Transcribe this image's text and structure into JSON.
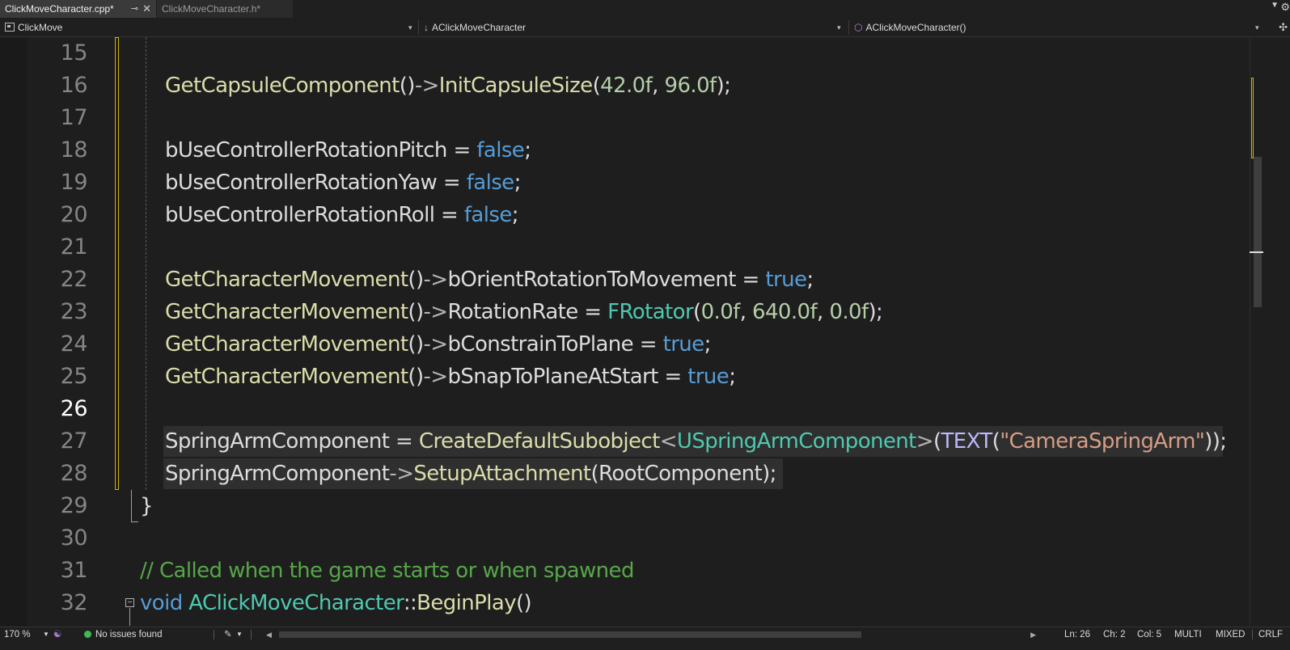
{
  "tabs": [
    {
      "label": "ClickMoveCharacter.cpp*",
      "active": true
    },
    {
      "label": "ClickMoveCharacter.h*",
      "active": false
    }
  ],
  "nav": {
    "project": "ClickMove",
    "class": "AClickMoveCharacter",
    "member": "AClickMoveCharacter()"
  },
  "editor": {
    "current_line": 26,
    "lines": [
      {
        "n": "15"
      },
      {
        "n": "16"
      },
      {
        "n": "17"
      },
      {
        "n": "18"
      },
      {
        "n": "19"
      },
      {
        "n": "20"
      },
      {
        "n": "21"
      },
      {
        "n": "22"
      },
      {
        "n": "23"
      },
      {
        "n": "24"
      },
      {
        "n": "25"
      },
      {
        "n": "26"
      },
      {
        "n": "27"
      },
      {
        "n": "28"
      },
      {
        "n": "29"
      },
      {
        "n": "30"
      },
      {
        "n": "31"
      },
      {
        "n": "32"
      }
    ],
    "code": {
      "l16": {
        "a": "GetCapsuleComponent",
        "b": "()",
        "c": "->",
        "d": "InitCapsuleSize",
        "e": "(",
        "f": "42.0f",
        "g": ", ",
        "h": "96.0f",
        "i": ");"
      },
      "l18": {
        "a": "bUseControllerRotationPitch = ",
        "b": "false",
        "c": ";"
      },
      "l19": {
        "a": "bUseControllerRotationYaw = ",
        "b": "false",
        "c": ";"
      },
      "l20": {
        "a": "bUseControllerRotationRoll = ",
        "b": "false",
        "c": ";"
      },
      "l22": {
        "a": "GetCharacterMovement",
        "b": "()",
        "c": "->",
        "d": "bOrientRotationToMovement = ",
        "e": "true",
        "f": ";"
      },
      "l23": {
        "a": "GetCharacterMovement",
        "b": "()",
        "c": "->",
        "d": "RotationRate = ",
        "e": "FRotator",
        "f": "(",
        "g": "0.0f",
        "h": ", ",
        "i": "640.0f",
        "j": ", ",
        "k": "0.0f",
        "l": ");"
      },
      "l24": {
        "a": "GetCharacterMovement",
        "b": "()",
        "c": "->",
        "d": "bConstrainToPlane = ",
        "e": "true",
        "f": ";"
      },
      "l25": {
        "a": "GetCharacterMovement",
        "b": "()",
        "c": "->",
        "d": "bSnapToPlaneAtStart = ",
        "e": "true",
        "f": ";"
      },
      "l27": {
        "a": "SpringArmComponent = ",
        "b": "CreateDefaultSubobject",
        "c": "<",
        "d": "USpringArmComponent",
        "e": ">",
        "f": "(",
        "g": "TEXT",
        "h": "(",
        "i": "\"CameraSpringArm\"",
        "j": "));"
      },
      "l28": {
        "a": "SpringArmComponent",
        "b": "->",
        "c": "SetupAttachment",
        "d": "(RootComponent);"
      },
      "l29": {
        "a": "}"
      },
      "l31": {
        "a": "// Called when the game starts or when spawned"
      },
      "l32": {
        "a": "void",
        "b": " ",
        "c": "AClickMoveCharacter",
        "d": "::",
        "e": "BeginPlay",
        "f": "()"
      }
    }
  },
  "colors": {
    "function": "#dcdcaa",
    "keyword": "#569cd6",
    "number": "#b5cea8",
    "type": "#4ec9b0",
    "string": "#d69d85",
    "comment": "#57a64a",
    "macro": "#beb7ff",
    "change_marker": "#d8b400"
  },
  "status": {
    "zoom": "170 %",
    "issues": "No issues found",
    "ln": "Ln: 26",
    "ch": "Ch: 2",
    "col": "Col: 5",
    "mode1": "MULTI",
    "mode2": "MIXED",
    "eol": "CRLF"
  }
}
